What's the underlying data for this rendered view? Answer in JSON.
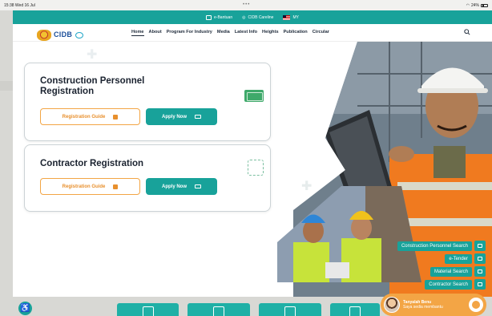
{
  "status_bar": {
    "time": "15:38",
    "date": "Wed 16 Jul",
    "battery": "24%"
  },
  "top_bar": {
    "items": [
      {
        "icon": "help-desk-icon",
        "label": "e-Bantuan"
      },
      {
        "icon": "location-pin-icon",
        "label": "CIDB Careline"
      },
      {
        "icon": "flag-icon",
        "label": "MY"
      }
    ]
  },
  "brand": {
    "name": "CIDB",
    "tagline": "MALAYSIA"
  },
  "nav": {
    "links": [
      "Home",
      "About",
      "Program For Industry",
      "Media",
      "Latest Info",
      "Heights",
      "Publication",
      "Circular"
    ],
    "active": "Home"
  },
  "cards": [
    {
      "title": "Construction Personnel Registration",
      "guide_label": "Registration Guide",
      "apply_label": "Apply Now",
      "illustration": "id-card-illustration"
    },
    {
      "title": "Contractor Registration",
      "guide_label": "Registration Guide",
      "apply_label": "Apply Now",
      "illustration": "certificate-illustration"
    }
  ],
  "quick_links": [
    {
      "label": "Construction Personnel Search",
      "icon": "id-card-icon"
    },
    {
      "label": "e-Tender",
      "icon": "document-icon"
    },
    {
      "label": "Material Search",
      "icon": "gear-icon"
    },
    {
      "label": "Contractor Search",
      "icon": "people-icon"
    }
  ],
  "chat": {
    "title": "Tanyalah Benu",
    "subtitle": "Saya sedia membantu"
  },
  "colors": {
    "teal": "#18a29a",
    "orange": "#f3a545",
    "navy": "#1c4f9a"
  }
}
